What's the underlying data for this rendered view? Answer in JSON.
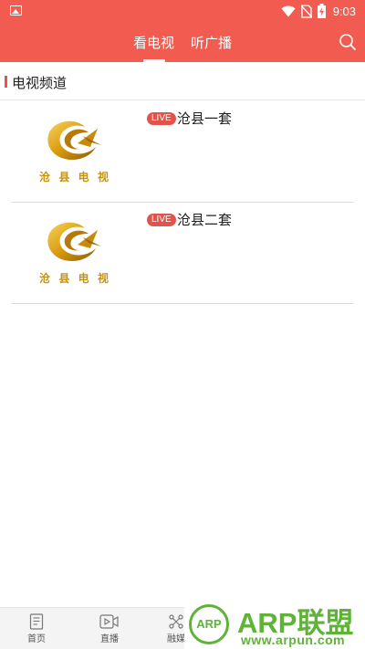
{
  "status_bar": {
    "time": "9:03",
    "left_icon": "image-icon",
    "icons": [
      "wifi-icon",
      "no-sim-icon",
      "battery-charging-icon"
    ]
  },
  "header": {
    "tabs": [
      {
        "label": "看电视",
        "active": true
      },
      {
        "label": "听广播",
        "active": false
      }
    ],
    "search_icon": "search-icon",
    "background_color": "#f25b4f"
  },
  "section": {
    "title": "电视频道",
    "accent_color": "#e8534a"
  },
  "channels": [
    {
      "name": "沧县一套",
      "badge": "LIVE",
      "logo_text": [
        "沧",
        "县",
        "电",
        "视"
      ]
    },
    {
      "name": "沧县二套",
      "badge": "LIVE",
      "logo_text": [
        "沧",
        "县",
        "电",
        "视"
      ]
    }
  ],
  "bottom_nav": [
    {
      "label": "首页",
      "icon": "document-icon"
    },
    {
      "label": "直播",
      "icon": "video-icon"
    },
    {
      "label": "融媒",
      "icon": "share-icon"
    }
  ],
  "watermark": {
    "circle_text": "ARP",
    "brand": "ARP联盟",
    "url": "www.arpun.com",
    "color": "#5fb336"
  }
}
